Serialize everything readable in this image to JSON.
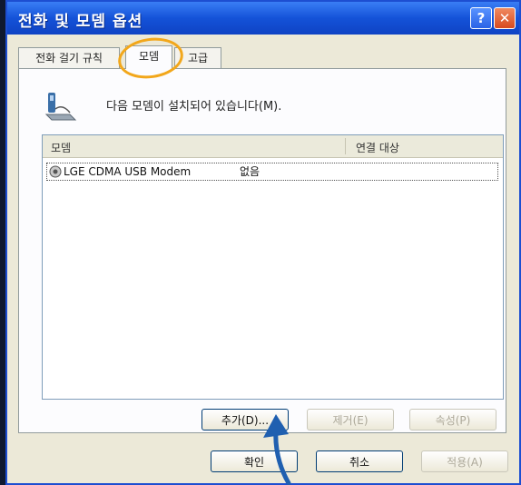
{
  "window": {
    "title": "전화 및 모뎀 옵션",
    "help_glyph": "?",
    "close_glyph": "✕"
  },
  "tabs": [
    {
      "label": "전화 걸기 규칙",
      "active": false
    },
    {
      "label": "모뎀",
      "active": true
    },
    {
      "label": "고급",
      "active": false
    }
  ],
  "panel": {
    "message": "다음 모뎀이 설치되어 있습니다(M).",
    "list": {
      "columns": [
        "모뎀",
        "연결 대상"
      ],
      "rows": [
        {
          "name": "LGE CDMA USB Modem",
          "port": "없음"
        }
      ]
    }
  },
  "panel_buttons": {
    "add": "추가(D)...",
    "remove": "제거(E)",
    "properties": "속성(P)"
  },
  "dialog_buttons": {
    "ok": "확인",
    "cancel": "취소",
    "apply": "적용(A)"
  },
  "colors": {
    "annotation_circle": "#f2a71b",
    "annotation_arrow": "#1f5fb0",
    "title_bar": "#1452d8"
  }
}
